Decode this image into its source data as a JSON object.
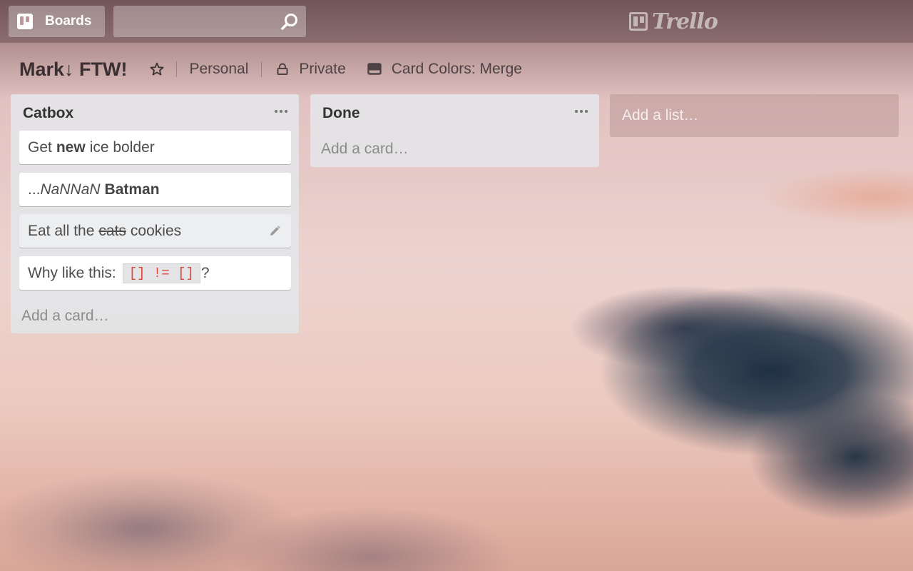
{
  "header": {
    "boards_label": "Boards",
    "search_placeholder": "",
    "logo_text": "Trello"
  },
  "board": {
    "title": "Mark↓ FTW!",
    "team": "Personal",
    "visibility": "Private",
    "card_colors": "Card Colors: Merge"
  },
  "lists": [
    {
      "title": "Catbox",
      "cards": [
        {
          "parts": [
            "Get",
            "new",
            "ice bolder"
          ]
        },
        {
          "parts": [
            "...",
            "NaNNaN",
            "Batman"
          ]
        },
        {
          "parts": [
            "Eat all the",
            "cats",
            "cookies"
          ]
        },
        {
          "parts": [
            "Why like this:",
            "[] != []",
            "?"
          ]
        }
      ],
      "add_card": "Add a card…"
    },
    {
      "title": "Done",
      "cards": [],
      "add_card": "Add a card…"
    }
  ],
  "add_list": "Add a list…",
  "colors": {
    "code_text": "#e0463c",
    "list_bg": "#e4e4e6"
  },
  "icons": [
    "boards-icon",
    "search-icon",
    "trello-logo-icon",
    "star-icon",
    "lock-icon",
    "card-colors-icon",
    "list-menu-icon",
    "pencil-icon"
  ]
}
